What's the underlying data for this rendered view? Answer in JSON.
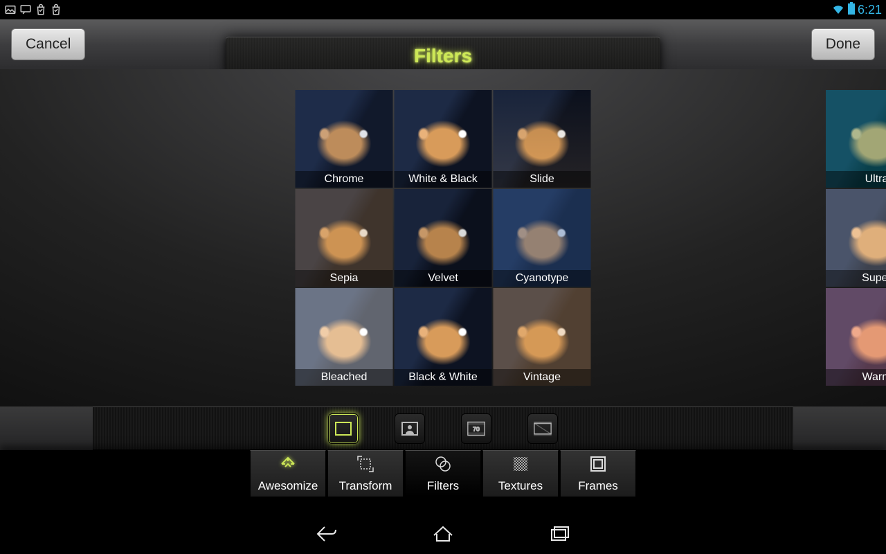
{
  "status": {
    "time": "6:21"
  },
  "header": {
    "cancel": "Cancel",
    "done": "Done",
    "title": "Filters"
  },
  "filters": {
    "main": [
      {
        "label": "Chrome",
        "cls": "ft-chrome"
      },
      {
        "label": "White & Black",
        "cls": "ft-bw"
      },
      {
        "label": "Slide",
        "cls": "ft-slide"
      },
      {
        "label": "Sepia",
        "cls": "ft-sepia"
      },
      {
        "label": "Velvet",
        "cls": "ft-velvet"
      },
      {
        "label": "Cyanotype",
        "cls": "ft-cyan"
      },
      {
        "label": "Bleached",
        "cls": "ft-bleach"
      },
      {
        "label": "Black & White",
        "cls": "ft-bw2"
      },
      {
        "label": "Vintage",
        "cls": "ft-vintage"
      }
    ],
    "side": [
      {
        "label": "Ultra",
        "cls": "ft-ultra"
      },
      {
        "label": "Super",
        "cls": "ft-super"
      },
      {
        "label": "Warm",
        "cls": "ft-warm"
      }
    ]
  },
  "toolstrip": {
    "icons": [
      "frame-icon",
      "portrait-icon",
      "film-70-icon",
      "filmstrip-icon"
    ],
    "active": 0,
    "film_label": "70"
  },
  "tabs": [
    {
      "label": "Awesomize",
      "name": "tab-awesomize"
    },
    {
      "label": "Transform",
      "name": "tab-transform"
    },
    {
      "label": "Filters",
      "name": "tab-filters",
      "active": true
    },
    {
      "label": "Textures",
      "name": "tab-textures"
    },
    {
      "label": "Frames",
      "name": "tab-frames"
    }
  ]
}
